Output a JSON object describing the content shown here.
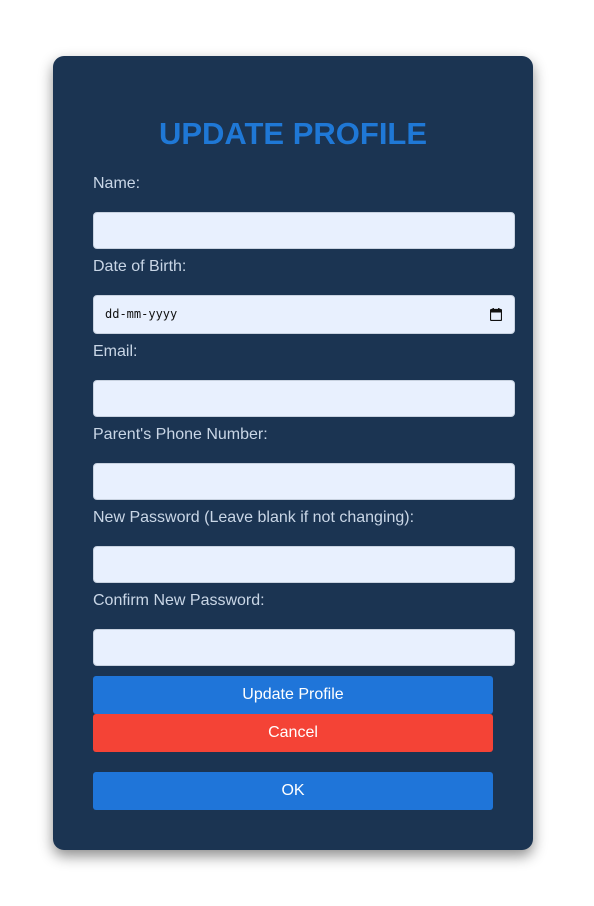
{
  "form": {
    "title": "UPDATE PROFILE",
    "fields": {
      "name": {
        "label": "Name:",
        "value": ""
      },
      "dob": {
        "label": "Date of Birth:",
        "placeholder": "dd-mm-yyyy"
      },
      "email": {
        "label": "Email:",
        "value": ""
      },
      "parent_phone": {
        "label": "Parent's Phone Number:",
        "value": ""
      },
      "new_password": {
        "label": "New Password (Leave blank if not changing):",
        "value": ""
      },
      "confirm_password": {
        "label": "Confirm New Password:",
        "value": ""
      }
    },
    "buttons": {
      "update": "Update Profile",
      "cancel": "Cancel",
      "ok": "OK"
    }
  },
  "icons": {
    "calendar": "calendar-icon"
  },
  "colors": {
    "card_background": "#1b3452",
    "title": "#1f78d6",
    "input_background": "#e8f0fe",
    "primary_button": "#1f75d9",
    "cancel_button": "#f44336",
    "label_text": "#c9d6e6"
  }
}
